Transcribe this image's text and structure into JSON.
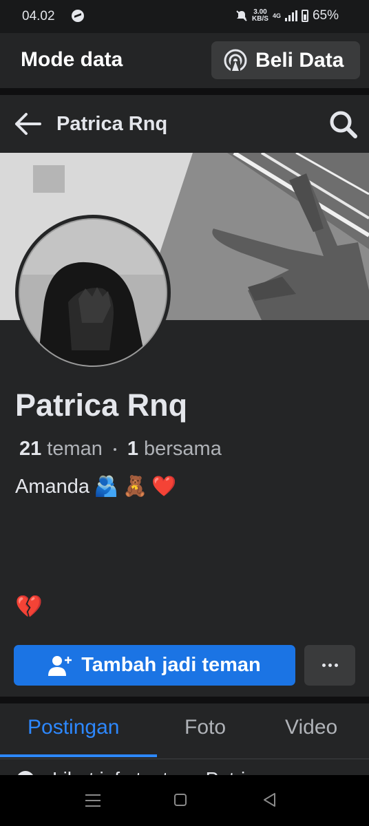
{
  "status_bar": {
    "time": "04.02",
    "speed_value": "3.00",
    "speed_unit": "KB/S",
    "network": "4G",
    "battery": "65%"
  },
  "mode_bar": {
    "title": "Mode data",
    "buy_button_label": "Beli Data",
    "icon": "signal-broadcast-icon"
  },
  "top_nav": {
    "title": "Patrica Rnq",
    "back_icon": "arrow-left-icon",
    "search_icon": "search-icon"
  },
  "profile": {
    "name": "Patrica Rnq",
    "friends_count": "21",
    "friends_label": "teman",
    "mutual_count": "1",
    "mutual_label": "bersama",
    "bio_text": "Amanda",
    "bio_emojis": [
      "🫂",
      "🧸",
      "❤️"
    ],
    "bio_second_line": "💔"
  },
  "actions": {
    "add_friend_label": "Tambah jadi teman",
    "more_label": "more-options"
  },
  "tabs": [
    {
      "label": "Postingan",
      "active": true
    },
    {
      "label": "Foto",
      "active": false
    },
    {
      "label": "Video",
      "active": false
    }
  ],
  "peek_text": "Lihat info tentang Patric",
  "colors": {
    "accent": "#1b74e4",
    "active_tab": "#2d88ff",
    "background": "#242526"
  }
}
